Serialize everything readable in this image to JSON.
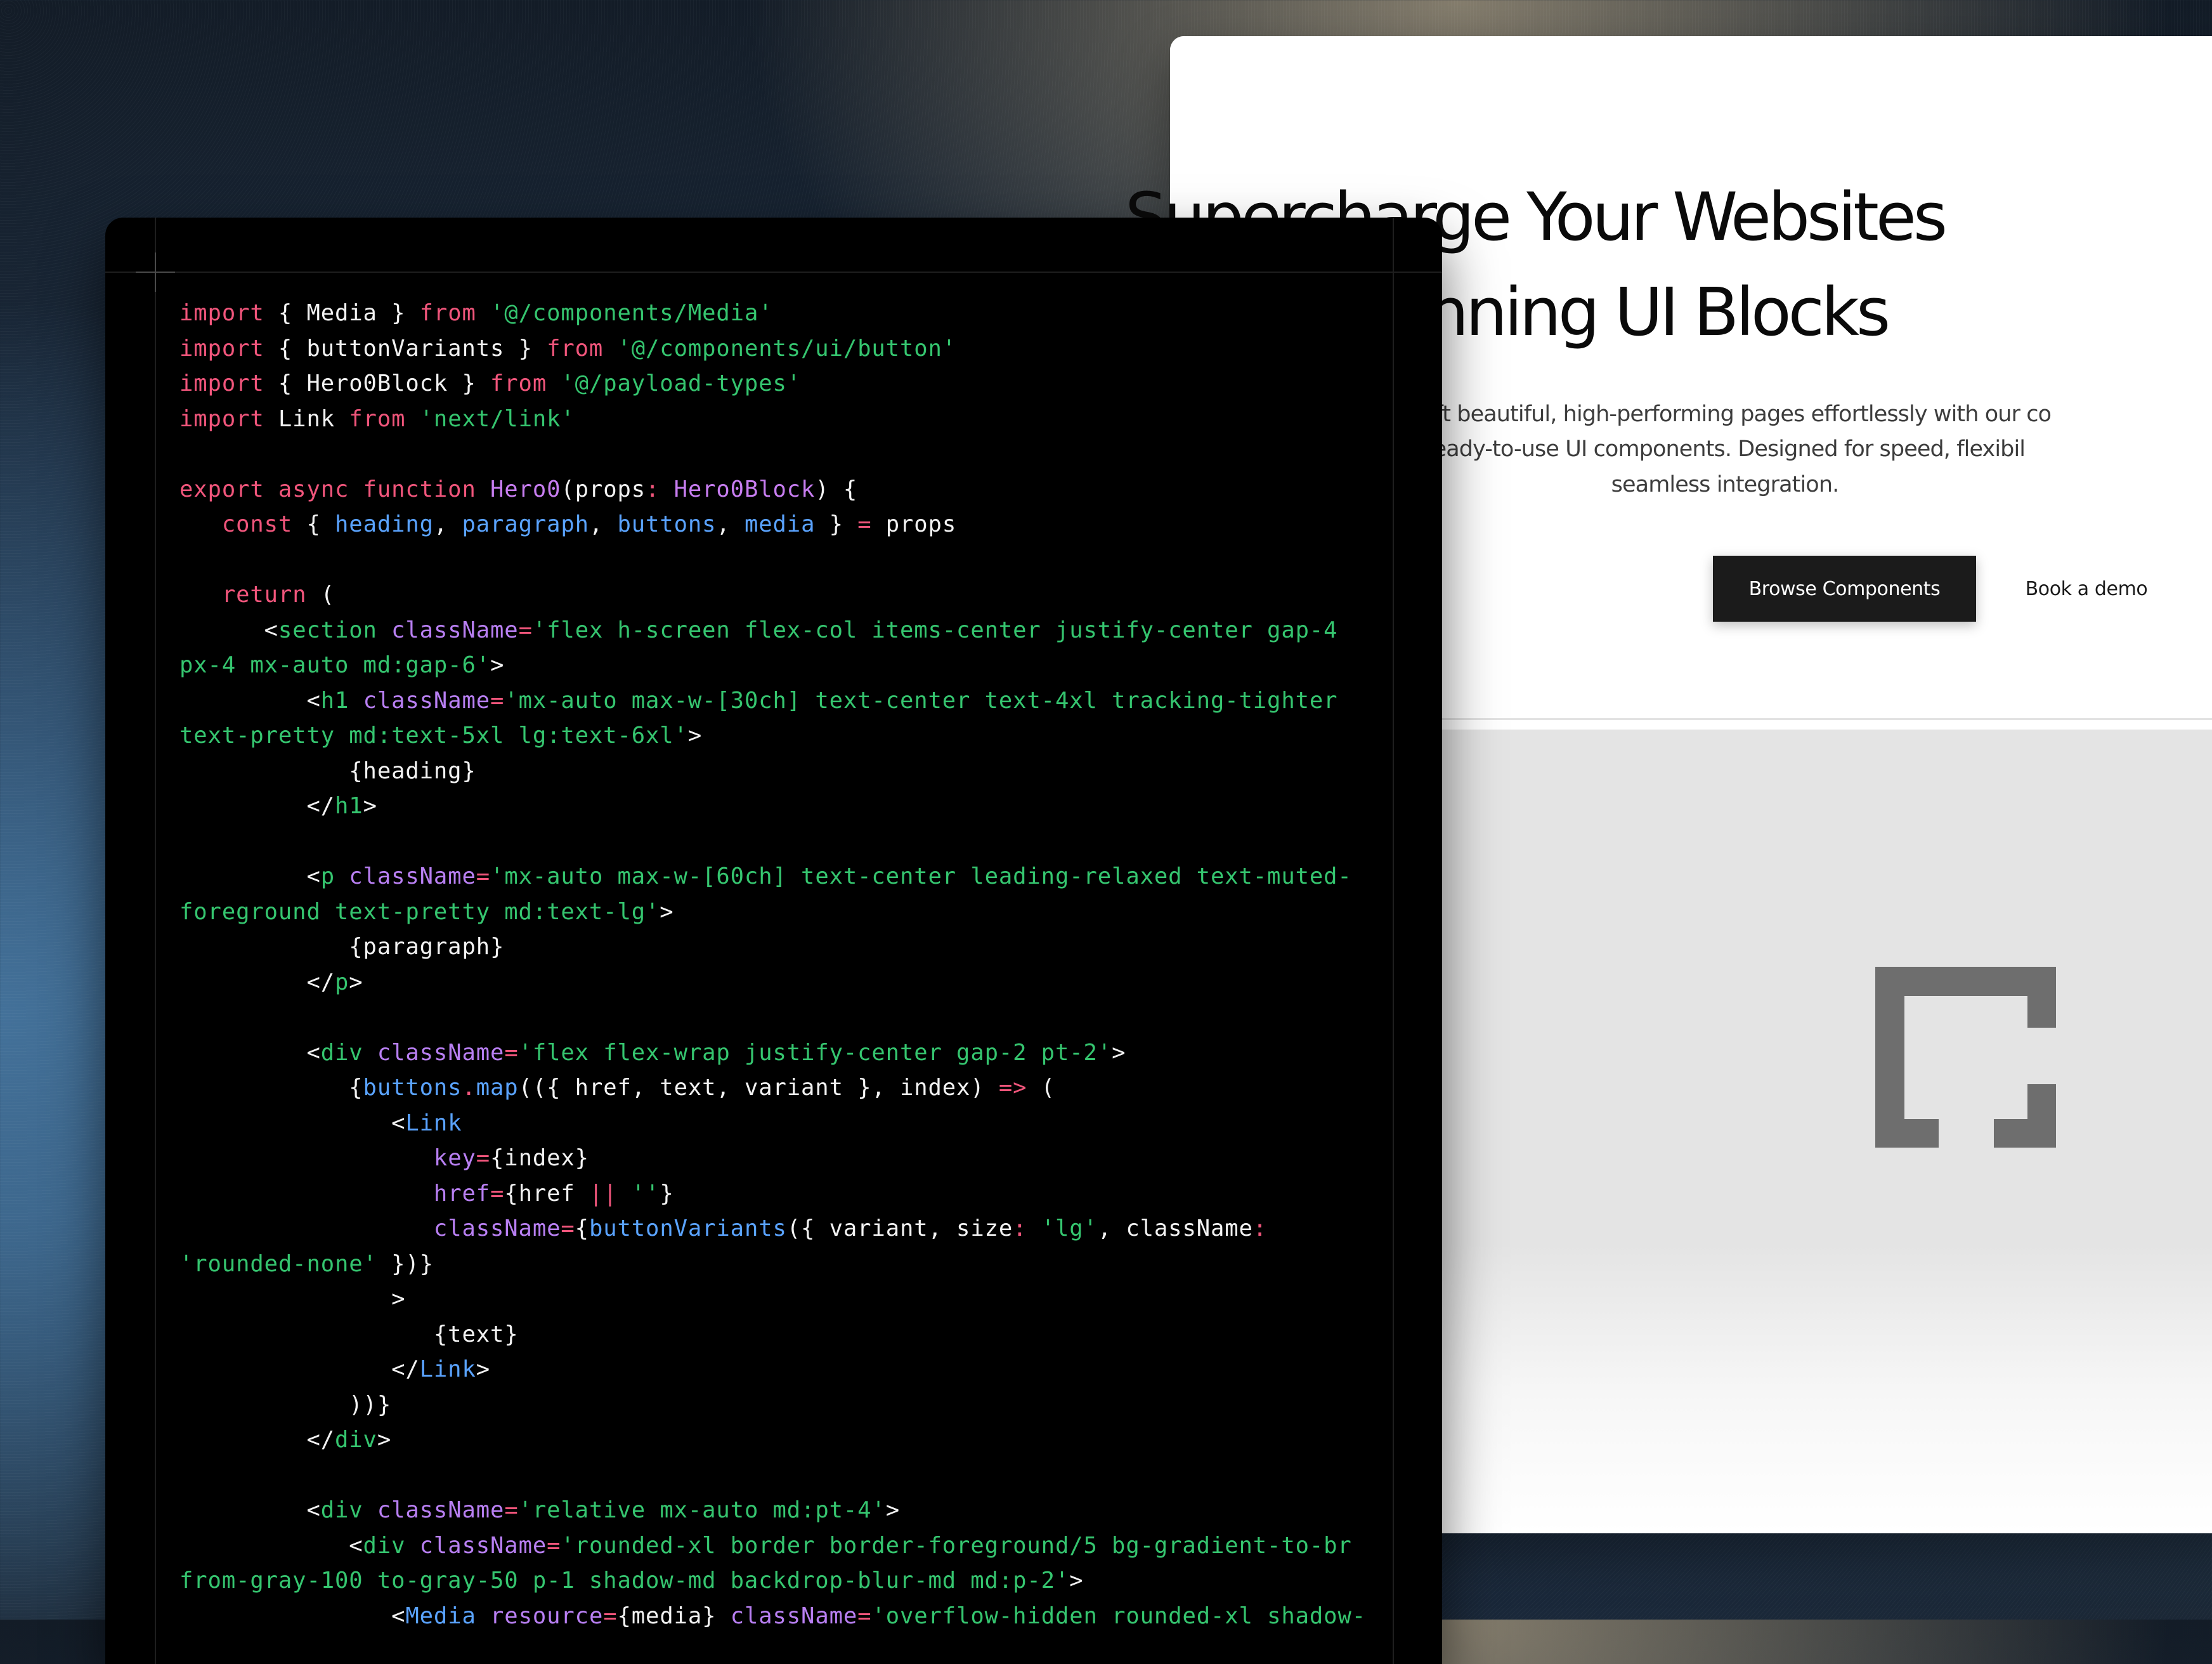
{
  "website_preview": {
    "headline_lines": [
      "Supercharge Your Websites",
      "with Stunning UI Blocks"
    ],
    "description_lines": [
      "Craft beautiful, high-performing pages effortlessly with our co",
      "ready-to-use UI components. Designed for speed, flexibil",
      "seamless integration."
    ],
    "primary_button": "Browse Components",
    "secondary_button": "Book a demo",
    "media_icon": "bracket-logo-icon",
    "colors": {
      "primary_button_bg": "#1b1b1b",
      "media_bg": "#e4e4e4",
      "logo": "#6e6e6e"
    }
  },
  "code_editor": {
    "theme_colors": {
      "background": "#000000",
      "keyword": "#f0557b",
      "string": "#35c56f",
      "function": "#c77df0",
      "variable": "#5aa3ff"
    },
    "lines": [
      [
        [
          "kw",
          "import"
        ],
        [
          "id",
          " { Media } "
        ],
        [
          "kw",
          "from"
        ],
        [
          "id",
          " "
        ],
        [
          "str",
          "'@/components/Media'"
        ]
      ],
      [
        [
          "kw",
          "import"
        ],
        [
          "id",
          " { buttonVariants } "
        ],
        [
          "kw",
          "from"
        ],
        [
          "id",
          " "
        ],
        [
          "str",
          "'@/components/ui/button'"
        ]
      ],
      [
        [
          "kw",
          "import"
        ],
        [
          "id",
          " { Hero0Block } "
        ],
        [
          "kw",
          "from"
        ],
        [
          "id",
          " "
        ],
        [
          "str",
          "'@/payload-types'"
        ]
      ],
      [
        [
          "kw",
          "import"
        ],
        [
          "id",
          " Link "
        ],
        [
          "kw",
          "from"
        ],
        [
          "id",
          " "
        ],
        [
          "str",
          "'next/link'"
        ]
      ],
      [],
      [
        [
          "kw",
          "export async function"
        ],
        [
          "id",
          " "
        ],
        [
          "fn",
          "Hero0"
        ],
        [
          "id",
          "(props"
        ],
        [
          "op",
          ":"
        ],
        [
          "id",
          " "
        ],
        [
          "fn",
          "Hero0Block"
        ],
        [
          "id",
          ") {"
        ]
      ],
      [
        [
          "id",
          "   "
        ],
        [
          "kw",
          "const"
        ],
        [
          "id",
          " { "
        ],
        [
          "var",
          "heading"
        ],
        [
          "id",
          ", "
        ],
        [
          "var",
          "paragraph"
        ],
        [
          "id",
          ", "
        ],
        [
          "var",
          "buttons"
        ],
        [
          "id",
          ", "
        ],
        [
          "var",
          "media"
        ],
        [
          "id",
          " } "
        ],
        [
          "op",
          "="
        ],
        [
          "id",
          " props"
        ]
      ],
      [],
      [
        [
          "id",
          "   "
        ],
        [
          "kw",
          "return"
        ],
        [
          "id",
          " ("
        ]
      ],
      [
        [
          "id",
          "      <"
        ],
        [
          "tag",
          "section"
        ],
        [
          "id",
          " "
        ],
        [
          "attr",
          "className"
        ],
        [
          "op",
          "="
        ],
        [
          "str",
          "'flex h-screen flex-col items-center justify-center gap-4"
        ]
      ],
      [
        [
          "str",
          "px-4 mx-auto md:gap-6'"
        ],
        [
          "id",
          ">"
        ]
      ],
      [
        [
          "id",
          "         <"
        ],
        [
          "tag",
          "h1"
        ],
        [
          "id",
          " "
        ],
        [
          "attr",
          "className"
        ],
        [
          "op",
          "="
        ],
        [
          "str",
          "'mx-auto max-w-[30ch] text-center text-4xl tracking-tighter"
        ]
      ],
      [
        [
          "str",
          "text-pretty md:text-5xl lg:text-6xl'"
        ],
        [
          "id",
          ">"
        ]
      ],
      [
        [
          "id",
          "            {heading}"
        ]
      ],
      [
        [
          "id",
          "         </"
        ],
        [
          "tag",
          "h1"
        ],
        [
          "id",
          ">"
        ]
      ],
      [],
      [
        [
          "id",
          "         <"
        ],
        [
          "tag",
          "p"
        ],
        [
          "id",
          " "
        ],
        [
          "attr",
          "className"
        ],
        [
          "op",
          "="
        ],
        [
          "str",
          "'mx-auto max-w-[60ch] text-center leading-relaxed text-muted-"
        ]
      ],
      [
        [
          "str",
          "foreground text-pretty md:text-lg'"
        ],
        [
          "id",
          ">"
        ]
      ],
      [
        [
          "id",
          "            {paragraph}"
        ]
      ],
      [
        [
          "id",
          "         </"
        ],
        [
          "tag",
          "p"
        ],
        [
          "id",
          ">"
        ]
      ],
      [],
      [
        [
          "id",
          "         <"
        ],
        [
          "tag",
          "div"
        ],
        [
          "id",
          " "
        ],
        [
          "attr",
          "className"
        ],
        [
          "op",
          "="
        ],
        [
          "str",
          "'flex flex-wrap justify-center gap-2 pt-2'"
        ],
        [
          "id",
          ">"
        ]
      ],
      [
        [
          "id",
          "            {"
        ],
        [
          "var",
          "buttons"
        ],
        [
          "op",
          "."
        ],
        [
          "var",
          "map"
        ],
        [
          "id",
          "(({ href, text, variant }, index) "
        ],
        [
          "op",
          "=>"
        ],
        [
          "id",
          " ("
        ]
      ],
      [
        [
          "id",
          "               <"
        ],
        [
          "var",
          "Link"
        ]
      ],
      [
        [
          "id",
          "                  "
        ],
        [
          "attr",
          "key"
        ],
        [
          "op",
          "="
        ],
        [
          "id",
          "{index}"
        ]
      ],
      [
        [
          "id",
          "                  "
        ],
        [
          "attr",
          "href"
        ],
        [
          "op",
          "="
        ],
        [
          "id",
          "{href "
        ],
        [
          "op",
          "||"
        ],
        [
          "id",
          " "
        ],
        [
          "str",
          "''"
        ],
        [
          "id",
          "}"
        ]
      ],
      [
        [
          "id",
          "                  "
        ],
        [
          "attr",
          "className"
        ],
        [
          "op",
          "="
        ],
        [
          "id",
          "{"
        ],
        [
          "var",
          "buttonVariants"
        ],
        [
          "id",
          "({ variant, size"
        ],
        [
          "op",
          ":"
        ],
        [
          "id",
          " "
        ],
        [
          "str",
          "'lg'"
        ],
        [
          "id",
          ", className"
        ],
        [
          "op",
          ":"
        ]
      ],
      [
        [
          "str",
          "'rounded-none'"
        ],
        [
          "id",
          " })}"
        ]
      ],
      [
        [
          "id",
          "               >"
        ]
      ],
      [
        [
          "id",
          "                  {text}"
        ]
      ],
      [
        [
          "id",
          "               </"
        ],
        [
          "var",
          "Link"
        ],
        [
          "id",
          ">"
        ]
      ],
      [
        [
          "id",
          "            ))}"
        ]
      ],
      [
        [
          "id",
          "         </"
        ],
        [
          "tag",
          "div"
        ],
        [
          "id",
          ">"
        ]
      ],
      [],
      [
        [
          "id",
          "         <"
        ],
        [
          "tag",
          "div"
        ],
        [
          "id",
          " "
        ],
        [
          "attr",
          "className"
        ],
        [
          "op",
          "="
        ],
        [
          "str",
          "'relative mx-auto md:pt-4'"
        ],
        [
          "id",
          ">"
        ]
      ],
      [
        [
          "id",
          "            <"
        ],
        [
          "tag",
          "div"
        ],
        [
          "id",
          " "
        ],
        [
          "attr",
          "className"
        ],
        [
          "op",
          "="
        ],
        [
          "str",
          "'rounded-xl border border-foreground/5 bg-gradient-to-br"
        ]
      ],
      [
        [
          "str",
          "from-gray-100 to-gray-50 p-1 shadow-md backdrop-blur-md md:p-2'"
        ],
        [
          "id",
          ">"
        ]
      ],
      [
        [
          "id",
          "               <"
        ],
        [
          "var",
          "Media"
        ],
        [
          "id",
          " "
        ],
        [
          "attr",
          "resource"
        ],
        [
          "op",
          "="
        ],
        [
          "id",
          "{media} "
        ],
        [
          "attr",
          "className"
        ],
        [
          "op",
          "="
        ],
        [
          "str",
          "'overflow-hidden rounded-xl shadow-"
        ]
      ]
    ]
  }
}
